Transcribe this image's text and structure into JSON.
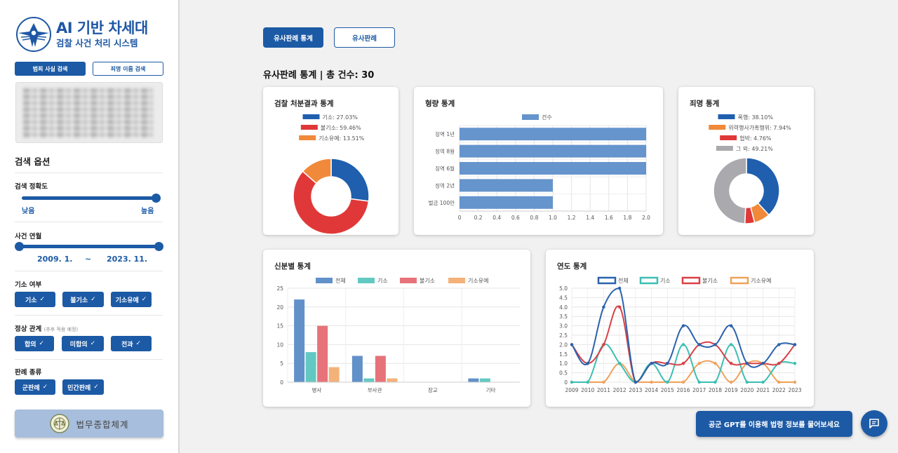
{
  "sidebar": {
    "logo_title": "AI 기반 차세대",
    "logo_subtitle": "검찰 사건 처리 시스템",
    "search_tabs": [
      "범죄 사실 검색",
      "죄명 이름 검색"
    ],
    "options_title": "검색 옵션",
    "accuracy": {
      "label": "검색 정확도",
      "low": "낮음",
      "high": "높음"
    },
    "period": {
      "label": "사건 연월",
      "from": "2009. 1.",
      "sep": "~",
      "to": "2023. 11."
    },
    "prosecution": {
      "label": "기소 여부",
      "chips": [
        "기소",
        "불기소",
        "기소유예"
      ]
    },
    "relation": {
      "label": "정상 관계",
      "note": "(추후 적용 예정)",
      "chips": [
        "합의",
        "미합의",
        "전과"
      ]
    },
    "verdict_type": {
      "label": "판례 종류",
      "chips": [
        "군판례",
        "민간판례"
      ]
    },
    "law_system_button": "법무종합체계",
    "check_glyph": "✓"
  },
  "tabs": [
    "유사판례 통계",
    "유사판례"
  ],
  "main_title": "유사판례 통계 | 총 건수: 30",
  "gpt_button": "공군 GPT를 이용해 법령 정보를 물어보세요",
  "chat_icon": "chat-bubble-icon",
  "colors": {
    "primary": "#1c5aa5",
    "blue": "#1f5fae",
    "red": "#e03838",
    "orange": "#f0893a",
    "gray": "#a9a9ae",
    "teal": "#3bbfb3"
  },
  "chart_data": [
    {
      "id": "disposition",
      "type": "pie",
      "title": "검찰 처분결과 통계",
      "legend": [
        "기소: 27.03%",
        "불기소: 59.46%",
        "기소유예: 13.51%"
      ],
      "values": [
        27.03,
        59.46,
        13.51
      ],
      "colors": [
        "#1f5fae",
        "#e03838",
        "#f0893a"
      ]
    },
    {
      "id": "sentence",
      "type": "bar",
      "orientation": "horizontal",
      "title": "형량 통계",
      "legend": [
        "건수"
      ],
      "categories": [
        "징역 1년",
        "징역 8월",
        "징역 6월",
        "징역 2년",
        "벌금 100만"
      ],
      "values": [
        2,
        2,
        2,
        1,
        1
      ],
      "xlim": [
        0,
        2
      ],
      "xticks": [
        "0",
        "0.2",
        "0.4",
        "0.6",
        "0.8",
        "1.0",
        "1.2",
        "1.4",
        "1.6",
        "1.8",
        "2.0"
      ],
      "color": "#6694cc"
    },
    {
      "id": "crime",
      "type": "pie",
      "title": "죄명 통계",
      "legend": [
        "폭행: 38.10%",
        "위력행사가혹행위: 7.94%",
        "협박: 4.76%",
        "그 외: 49.21%"
      ],
      "values": [
        38.1,
        7.94,
        4.76,
        49.21
      ],
      "colors": [
        "#1f5fae",
        "#f0893a",
        "#e03838",
        "#a9a9ae"
      ]
    },
    {
      "id": "status",
      "type": "bar",
      "title": "신분별 통계",
      "categories": [
        "병사",
        "부사관",
        "장교",
        "기타"
      ],
      "series": [
        {
          "name": "전체",
          "values": [
            22,
            7,
            0,
            1
          ],
          "color": "#6291c9"
        },
        {
          "name": "기소",
          "values": [
            8,
            1,
            0,
            1
          ],
          "color": "#62c9c2"
        },
        {
          "name": "불기소",
          "values": [
            15,
            7,
            0,
            0
          ],
          "color": "#e7727a"
        },
        {
          "name": "기소유예",
          "values": [
            4,
            1,
            0,
            0
          ],
          "color": "#f3b27a"
        }
      ],
      "ylim": [
        0,
        25
      ],
      "yticks": [
        "0",
        "5",
        "10",
        "15",
        "20",
        "25"
      ]
    },
    {
      "id": "yearly",
      "type": "line",
      "title": "연도 통계",
      "x": [
        "2009",
        "2010",
        "2011",
        "2012",
        "2013",
        "2014",
        "2015",
        "2016",
        "2017",
        "2018",
        "2019",
        "2020",
        "2021",
        "2022",
        "2023"
      ],
      "series": [
        {
          "name": "전체",
          "values": [
            2,
            1,
            4,
            5,
            0,
            1,
            1,
            3,
            2,
            2,
            3,
            1,
            1,
            2,
            2
          ],
          "color": "#2a62ad"
        },
        {
          "name": "기소",
          "values": [
            0,
            0,
            2,
            1,
            0,
            1,
            0,
            2,
            0,
            0,
            2,
            0,
            0,
            1,
            1
          ],
          "color": "#3bbfb3"
        },
        {
          "name": "불기소",
          "values": [
            2,
            1,
            2,
            4,
            0,
            1,
            1,
            1,
            2,
            2,
            1,
            1,
            1,
            1,
            2
          ],
          "color": "#d94045"
        },
        {
          "name": "기소유예",
          "values": [
            0,
            0,
            0,
            1,
            0,
            0,
            0,
            0,
            1,
            1,
            0,
            1,
            1,
            0,
            0
          ],
          "color": "#f0a15a"
        }
      ],
      "ylim": [
        0,
        5
      ],
      "yticks": [
        "0",
        "0.5",
        "1.0",
        "1.5",
        "2.0",
        "2.5",
        "3.0",
        "3.5",
        "4.0",
        "4.5",
        "5.0"
      ]
    }
  ]
}
